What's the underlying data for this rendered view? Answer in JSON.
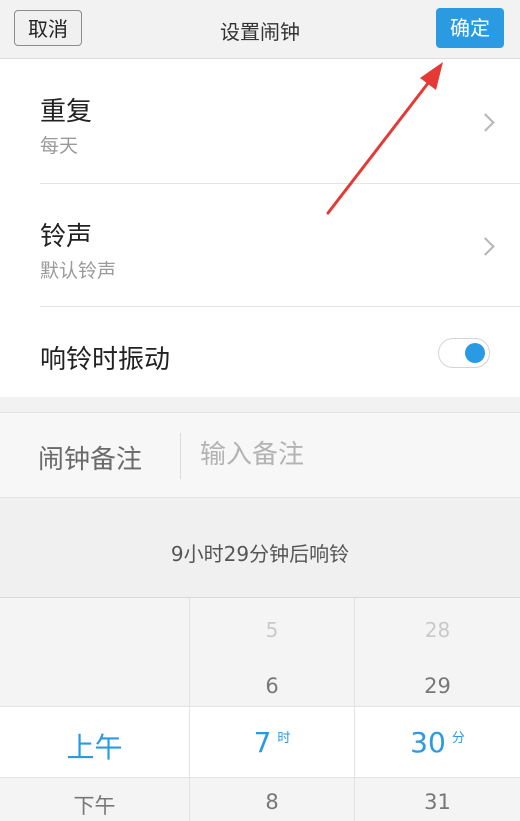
{
  "header": {
    "cancel_label": "取消",
    "title": "设置闹钟",
    "confirm_label": "确定"
  },
  "settings": {
    "repeat": {
      "label": "重复",
      "value": "每天"
    },
    "ringtone": {
      "label": "铃声",
      "value": "默认铃声"
    },
    "vibrate": {
      "label": "响铃时振动",
      "enabled": true
    }
  },
  "note": {
    "label": "闹钟备注",
    "placeholder": "输入备注",
    "value": ""
  },
  "countdown_text": "9小时29分钟后响铃",
  "picker": {
    "ampm": {
      "selected": "上午",
      "below": "下午"
    },
    "hour": {
      "above2": "5",
      "above1": "6",
      "selected": "7",
      "unit": "时",
      "below": "8"
    },
    "minute": {
      "above2": "28",
      "above1": "29",
      "selected": "30",
      "unit": "分",
      "below": "31"
    }
  },
  "colors": {
    "accent": "#2a9be3",
    "annotation_arrow": "#e53935"
  }
}
